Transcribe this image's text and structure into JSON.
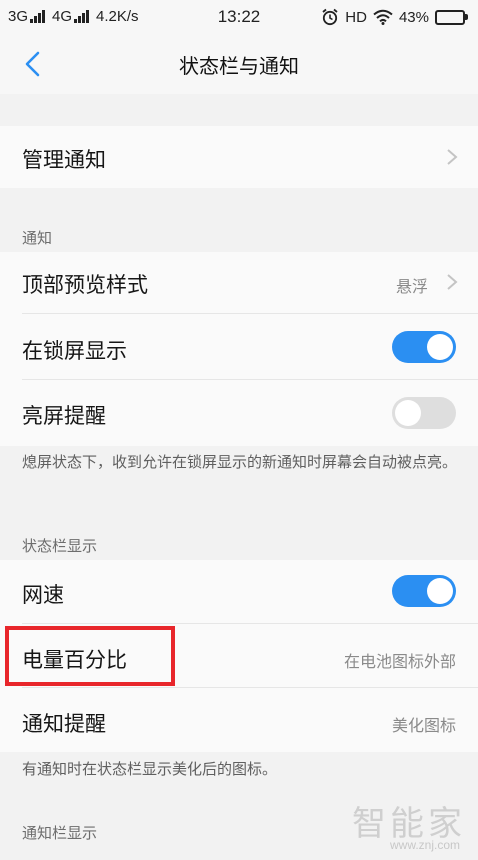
{
  "status_bar": {
    "network_1": "3G",
    "network_2": "4G",
    "speed": "4.2K/s",
    "time": "13:22",
    "hd": "HD",
    "battery_percent_text": "43%",
    "battery_level": 0.43,
    "icons": [
      "signal-icon",
      "alarm-icon",
      "wifi-icon",
      "battery-icon"
    ]
  },
  "nav": {
    "title": "状态栏与通知",
    "back_icon": "chevron-left-icon"
  },
  "items": {
    "manage": {
      "label": "管理通知"
    },
    "top_preview": {
      "label": "顶部预览样式",
      "value": "悬浮"
    },
    "lock_screen": {
      "label": "在锁屏显示",
      "on": true
    },
    "wake_screen": {
      "label": "亮屏提醒",
      "on": false
    },
    "net_speed": {
      "label": "网速",
      "on": true
    },
    "battery_pct": {
      "label": "电量百分比",
      "value": "在电池图标外部"
    },
    "notif_reminder": {
      "label": "通知提醒",
      "value": "美化图标"
    }
  },
  "sections": {
    "notification": "通知",
    "status_bar_display": "状态栏显示",
    "notification_bar_display": "通知栏显示"
  },
  "footnotes": {
    "wake": "熄屏状态下，收到允许在锁屏显示的新通知时屏幕会自动被点亮。",
    "notif": "有通知时在状态栏显示美化后的图标。"
  },
  "watermark": {
    "logo": "智能家",
    "url": "www.znj.com"
  },
  "colors": {
    "accent": "#2b8ff2",
    "highlight": "#e8262b"
  }
}
